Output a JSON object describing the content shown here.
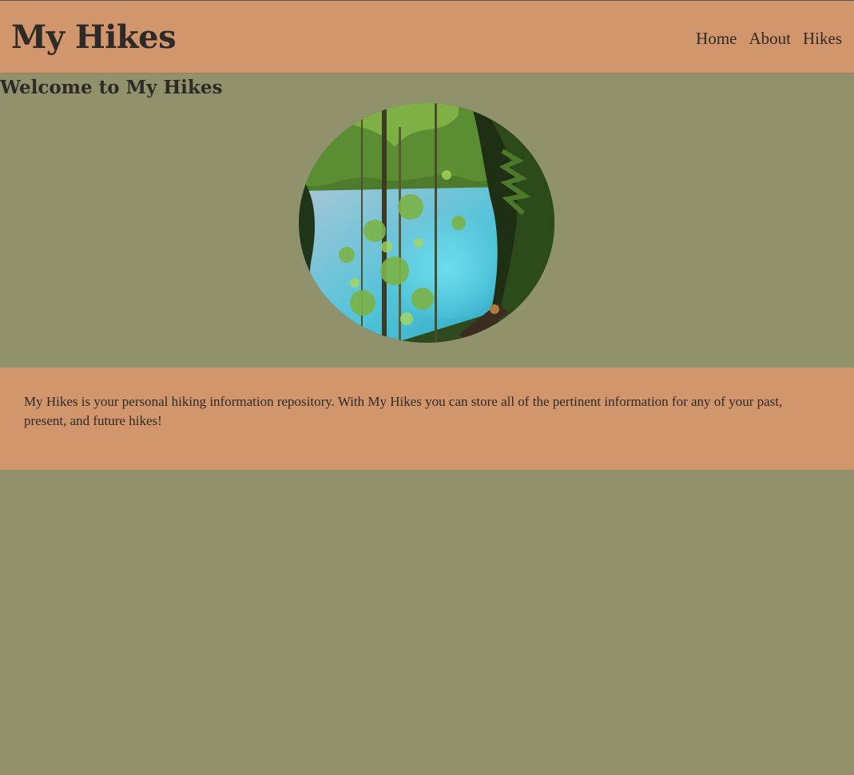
{
  "header": {
    "title": "My Hikes",
    "nav": [
      {
        "label": "Home"
      },
      {
        "label": "About"
      },
      {
        "label": "Hikes"
      }
    ]
  },
  "main": {
    "heading": "Welcome to My Hikes",
    "hero_image": "forest-river-photo",
    "intro": "My Hikes is your personal hiking information repository. With My Hikes you can store all of the pertinent information for any of your past, present, and future hikes!"
  },
  "colors": {
    "page_background": "#8f926a",
    "panel_background": "#d1966c",
    "text": "#2e2a28"
  }
}
